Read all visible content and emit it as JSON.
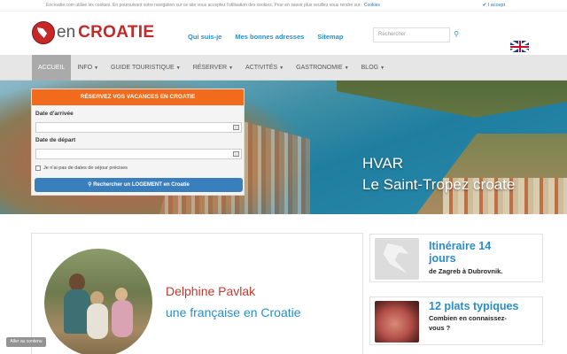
{
  "cookie": {
    "text": "Encroatie.com utilise les cookies. En poursuivant votre navigation sur ce site vous acceptez l'utilisation des cookies. Pour en savoir plus veuillez vous rendre sur:",
    "link": "Cookies",
    "accept": "✔ I accept"
  },
  "logo": {
    "en": "en",
    "croatie": "CROATIE"
  },
  "toplinks": [
    "Qui suis-je",
    "Mes bonnes adresses",
    "Sitemap"
  ],
  "search": {
    "placeholder": "Rechercher"
  },
  "nav": [
    {
      "label": "Accueil",
      "caret": false,
      "active": true
    },
    {
      "label": "Info",
      "caret": true
    },
    {
      "label": "Guide touristique",
      "caret": true
    },
    {
      "label": "Réserver",
      "caret": true
    },
    {
      "label": "Activités",
      "caret": true
    },
    {
      "label": "Gastronomie",
      "caret": true
    },
    {
      "label": "Blog",
      "caret": true
    }
  ],
  "hero": {
    "title": "HVAR",
    "subtitle": "Le Saint-Tropez croate"
  },
  "booking": {
    "header": "Réservez vos vacances en Croatie",
    "arrival_label": "Date d'arrivée",
    "departure_label": "Date de départ",
    "no_dates": "Je n'ai pas de dates de séjour précises",
    "button": "Rechercher un LOGEMENT en Croatie"
  },
  "profile": {
    "name": "Delphine Pavlak",
    "tagline": "une française en Croatie"
  },
  "cards": [
    {
      "title_line1": "Itinéraire 14",
      "title_line2": "jours",
      "text_line1": "de Zagreb à Dubrovnik.",
      "text_line2": ""
    },
    {
      "title_line1": "12 plats typiques",
      "title_line2": "",
      "text_line1": "Combien en connaissez-",
      "text_line2": "vous ?"
    }
  ],
  "scroll_top": "Aller au contenu",
  "colors": {
    "brand_red": "#c62828",
    "link_blue": "#2a8dc8",
    "booking_orange": "#f26a1b",
    "button_blue": "#3a7fbd"
  }
}
